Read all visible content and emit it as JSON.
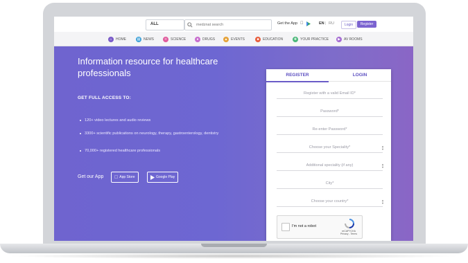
{
  "topbar": {
    "search_category": "ALL",
    "search_placeholder": "medznat search",
    "get_app_label": "Get the App",
    "lang_en": "EN",
    "lang_separator": "|",
    "lang_ru": "RU",
    "login_label": "Login",
    "register_label": "Register"
  },
  "nav": {
    "items": [
      {
        "label": "HOME",
        "icon": "home-icon",
        "color": "#7a5bc9"
      },
      {
        "label": "NEWS",
        "icon": "news-icon",
        "color": "#3fa1d8"
      },
      {
        "label": "SCIENCE",
        "icon": "science-icon",
        "color": "#e05a9c"
      },
      {
        "label": "DRUGS",
        "icon": "drugs-icon",
        "color": "#c86fce"
      },
      {
        "label": "EVENTS",
        "icon": "events-icon",
        "color": "#e6a33a"
      },
      {
        "label": "EDUCATION",
        "icon": "education-icon",
        "color": "#e85e3d"
      },
      {
        "label": "YOUR PRACTICE",
        "icon": "practice-icon",
        "color": "#4cb87a"
      },
      {
        "label": "AV ROOMS",
        "icon": "av-rooms-icon",
        "color": "#a56bd3"
      }
    ]
  },
  "hero": {
    "title": "Information resource for healthcare professionals",
    "access_title": "GET FULL ACCESS TO:",
    "bullets": [
      "120+ video lectures and audio reviews",
      "3300+ scientific publications on neurology, therapy, gastroenterology, dentistry",
      "70,000+ registered healthcare professionals"
    ],
    "get_our_app": "Get our App",
    "app_store": "App Store",
    "google_play": "Google Play"
  },
  "form": {
    "tab_register": "REGISTER",
    "tab_login": "LOGIN",
    "fields": [
      "Register with a valid Email ID*",
      "Password*",
      "Re-enter Password*",
      "Choose your Speciality*",
      "Additional speciality (if any)",
      "City*",
      "Choose your country*"
    ],
    "captcha_label": "I'm not a robot",
    "captcha_brand": "reCAPTCHA",
    "captcha_links": "Privacy - Terms"
  },
  "colors": {
    "accent": "#6a5bc7",
    "hero_start": "#6f64cf",
    "hero_end": "#8a66c6"
  }
}
